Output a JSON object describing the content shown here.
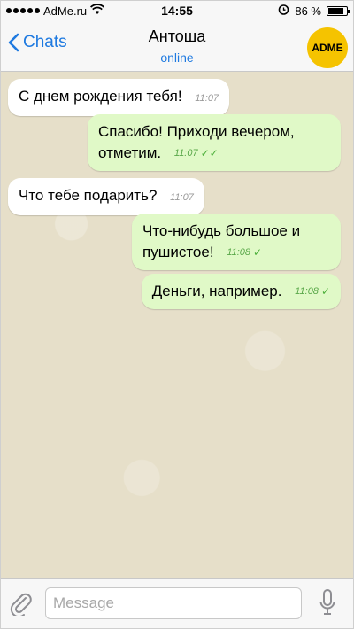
{
  "statusbar": {
    "carrier": "AdMe.ru",
    "time": "14:55",
    "battery": "86 %",
    "battery_level": 0.86
  },
  "navbar": {
    "back_label": "Chats",
    "title": "Антоша",
    "subtitle": "online",
    "avatar_text": "ADME"
  },
  "messages": [
    {
      "text": "С днем рождения тебя!",
      "time": "11:07",
      "direction": "in"
    },
    {
      "text": "Спасибо! Приходи вечером, отметим.",
      "time": "11:07",
      "direction": "out",
      "status": "read"
    },
    {
      "text": "Что тебе подарить?",
      "time": "11:07",
      "direction": "in"
    },
    {
      "text": "Что-нибудь большое и пушистое!",
      "time": "11:08",
      "direction": "out",
      "status": "sent"
    },
    {
      "text": "Деньги, например.",
      "time": "11:08",
      "direction": "out",
      "status": "sent"
    }
  ],
  "input": {
    "placeholder": "Message"
  },
  "colors": {
    "accent": "#1f7ae0",
    "outgoing_bubble": "#e0f9c7",
    "incoming_bubble": "#ffffff",
    "chat_background": "#e6dfc9",
    "avatar": "#f5c300"
  }
}
